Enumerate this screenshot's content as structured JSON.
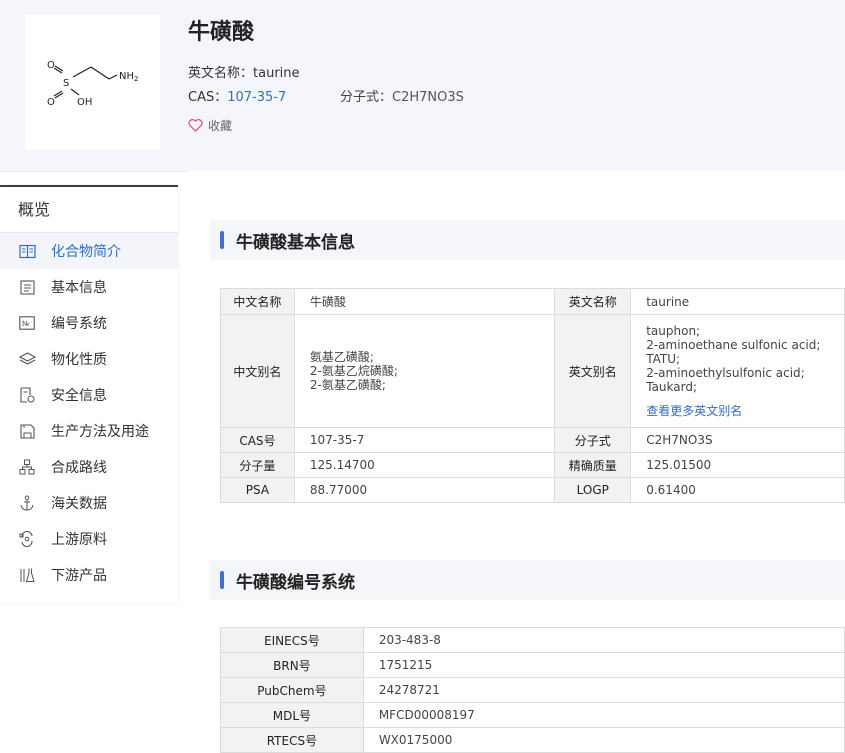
{
  "compound": {
    "name": "牛磺酸",
    "english_label": "英文名称：",
    "english_name": "taurine",
    "cas_label": "CAS：",
    "cas": "107-35-7",
    "formula_label": "分子式：",
    "formula": "C2H7NO3S",
    "favorite_label": "收藏"
  },
  "structure": {
    "atoms": {
      "o1": "O",
      "o2": "O",
      "s": "S",
      "oh": "OH",
      "nh2": "NH",
      "nh2_sub": "2"
    }
  },
  "sidebar": {
    "overview": "概览",
    "items": [
      {
        "label": "化合物简介",
        "icon": "book-icon",
        "active": true
      },
      {
        "label": "基本信息",
        "icon": "list-icon",
        "active": false
      },
      {
        "label": "编号系统",
        "icon": "number-icon",
        "active": false
      },
      {
        "label": "物化性质",
        "icon": "layers-icon",
        "active": false
      },
      {
        "label": "安全信息",
        "icon": "safety-doc-icon",
        "active": false
      },
      {
        "label": "生产方法及用途",
        "icon": "save-icon",
        "active": false
      },
      {
        "label": "合成路线",
        "icon": "hierarchy-icon",
        "active": false
      },
      {
        "label": "海关数据",
        "icon": "anchor-icon",
        "active": false
      },
      {
        "label": "上游原料",
        "icon": "cycle-icon",
        "active": false
      },
      {
        "label": "下游产品",
        "icon": "flask-icon",
        "active": false
      }
    ]
  },
  "basic_info": {
    "title": "牛磺酸基本信息",
    "cn_name_label": "中文名称",
    "cn_name": "牛磺酸",
    "en_name_label": "英文名称",
    "en_name": "taurine",
    "cn_alias_label": "中文别名",
    "cn_aliases": [
      "氨基乙磺酸;",
      "2-氨基乙烷磺酸;",
      "2-氨基乙磺酸;"
    ],
    "en_alias_label": "英文别名",
    "en_aliases": [
      "tauphon;",
      "2-aminoethane sulfonic acid;",
      "TATU;",
      "2-aminoethylsulfonic acid;",
      "Taukard;"
    ],
    "more_aliases": "查看更多英文别名",
    "cas_label": "CAS号",
    "cas": "107-35-7",
    "formula_label": "分子式",
    "formula": "C2H7NO3S",
    "mw_label": "分子量",
    "mw": "125.14700",
    "exact_mass_label": "精确质量",
    "exact_mass": "125.01500",
    "psa_label": "PSA",
    "psa": "88.77000",
    "logp_label": "LOGP",
    "logp": "0.61400"
  },
  "numbering": {
    "title": "牛磺酸编号系统",
    "rows": [
      {
        "label": "EINECS号",
        "value": "203-483-8"
      },
      {
        "label": "BRN号",
        "value": "1751215"
      },
      {
        "label": "PubChem号",
        "value": "24278721"
      },
      {
        "label": "MDL号",
        "value": "MFCD00008197"
      },
      {
        "label": "RTECS号",
        "value": "WX0175000"
      }
    ]
  }
}
